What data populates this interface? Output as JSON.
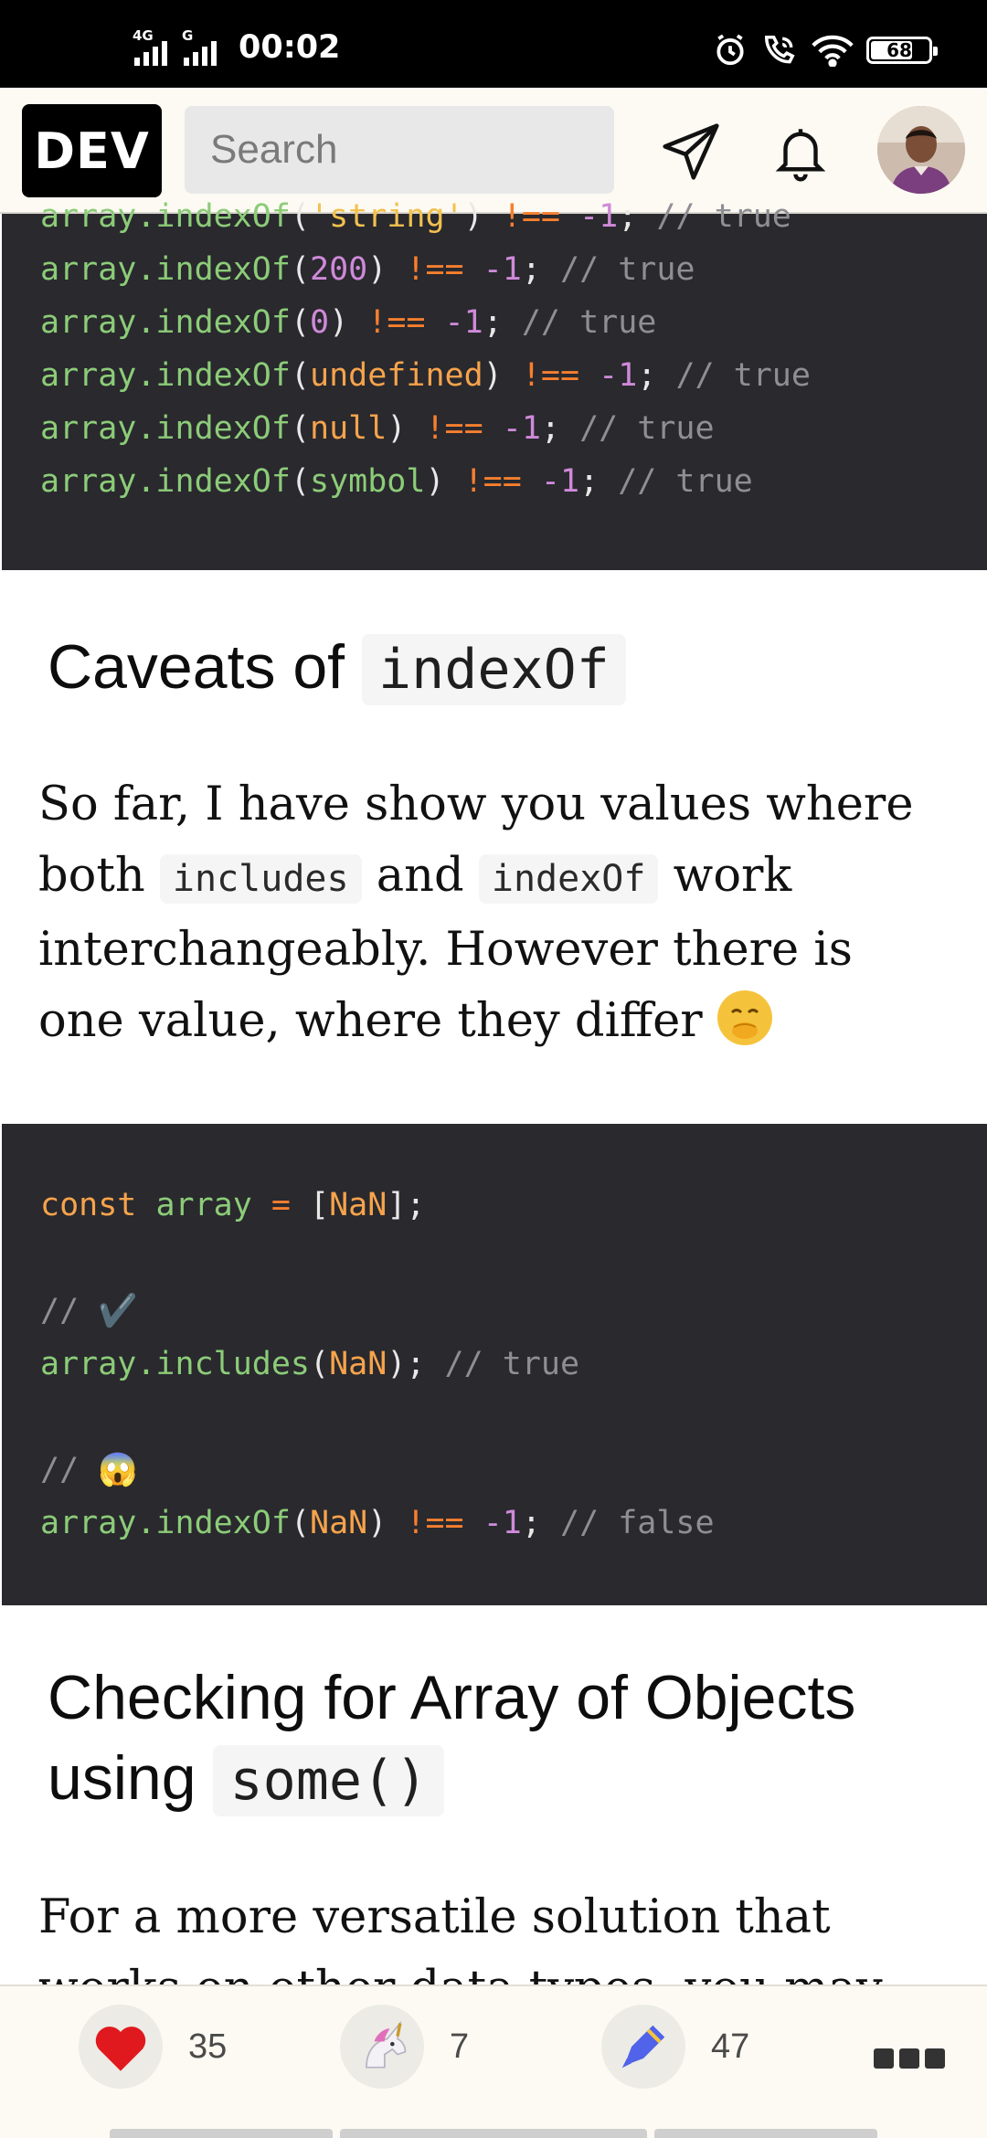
{
  "status_bar": {
    "network_1": "4G",
    "network_2": "G",
    "time": "00:02",
    "battery": "68",
    "icons": [
      "alarm-icon",
      "wifi-calling-icon",
      "wifi-icon",
      "battery-icon"
    ]
  },
  "header": {
    "logo": "DEV",
    "search_placeholder": "Search",
    "icons": [
      "send-icon",
      "bell-icon",
      "avatar"
    ]
  },
  "code_block_1": {
    "lines": [
      {
        "fn": "array.indexOf",
        "arg": "'string'",
        "arg_type": "str",
        "cmp": "!==",
        "num": "-1",
        "comment": "// true"
      },
      {
        "fn": "array.indexOf",
        "arg": "200",
        "arg_type": "num",
        "cmp": "!==",
        "num": "-1",
        "comment": "// true"
      },
      {
        "fn": "array.indexOf",
        "arg": "0",
        "arg_type": "num",
        "cmp": "!==",
        "num": "-1",
        "comment": "// true"
      },
      {
        "fn": "array.indexOf",
        "arg": "undefined",
        "arg_type": "kw",
        "cmp": "!==",
        "num": "-1",
        "comment": "// true"
      },
      {
        "fn": "array.indexOf",
        "arg": "null",
        "arg_type": "kw",
        "cmp": "!==",
        "num": "-1",
        "comment": "// true"
      },
      {
        "fn": "array.indexOf",
        "arg": "symbol",
        "arg_type": "fn",
        "cmp": "!==",
        "num": "-1",
        "comment": "// true"
      }
    ]
  },
  "heading_1": {
    "text": "Caveats of ",
    "code": "indexOf"
  },
  "paragraph_1": {
    "part1": "So far, I have show you values where both ",
    "code1": "includes",
    "part2": " and ",
    "code2": "indexOf",
    "part3": " work interchangeably. However there is one value, where they differ "
  },
  "code_block_2": {
    "line1": {
      "kw": "const",
      "name": "array",
      "op": "=",
      "open": "[",
      "val": "NaN",
      "close": "];"
    },
    "comment1": "// ✔️",
    "line2": {
      "fn": "array.includes",
      "val": "NaN",
      "end": ");",
      "comment": "// true"
    },
    "comment2": "// 😱",
    "line3": {
      "fn": "array.indexOf",
      "val": "NaN",
      "cmp": "!==",
      "num": "-1",
      "comment": "// false"
    }
  },
  "heading_2": {
    "line1": "Checking for Array of Objects",
    "line2": "using ",
    "code": "some()"
  },
  "paragraph_2": {
    "line1": "For a more versatile solution that",
    "line2": "works on other data types, you may"
  },
  "actions": {
    "heart_count": "35",
    "unicorn_count": "7",
    "saved_count": "47"
  },
  "colors": {
    "code_bg": "#29292e",
    "function": "#8ccc78",
    "string": "#f2c14e",
    "number": "#cf8ad9",
    "operator": "#f77f2e",
    "comment": "#8e8e93"
  }
}
